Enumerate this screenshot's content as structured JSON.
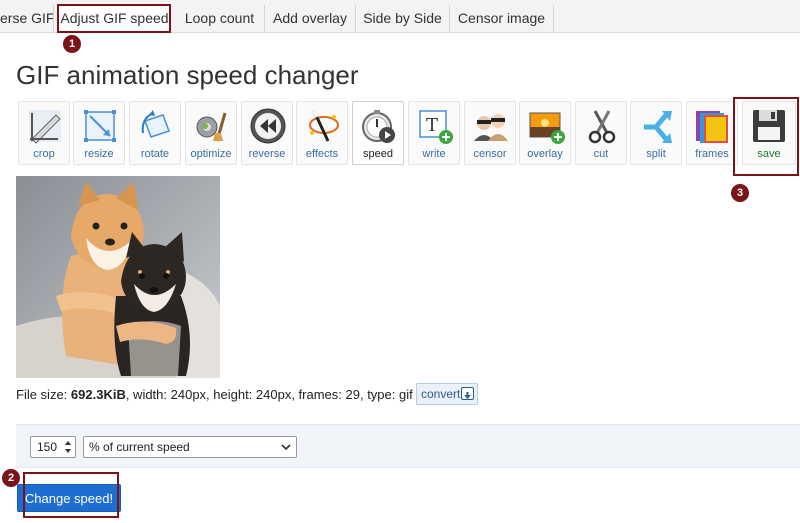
{
  "tabs": [
    "erse GIF",
    "Adjust GIF speed",
    "Loop count",
    "Add overlay",
    "Side by Side",
    "Censor image"
  ],
  "annotations": [
    "1",
    "2",
    "3"
  ],
  "page_title": "GIF animation speed changer",
  "tools": [
    "crop",
    "resize",
    "rotate",
    "optimize",
    "reverse",
    "effects",
    "speed",
    "write",
    "censor",
    "overlay",
    "cut",
    "split",
    "frames",
    "save"
  ],
  "file_info": {
    "label_size": "File size: ",
    "size": "692.3KiB",
    "rest": ", width: 240px, height: 240px, frames: 29, type: gif"
  },
  "convert_label": "convert",
  "speed_value": "150",
  "speed_mode": "% of current speed",
  "submit_label": "Change speed!"
}
